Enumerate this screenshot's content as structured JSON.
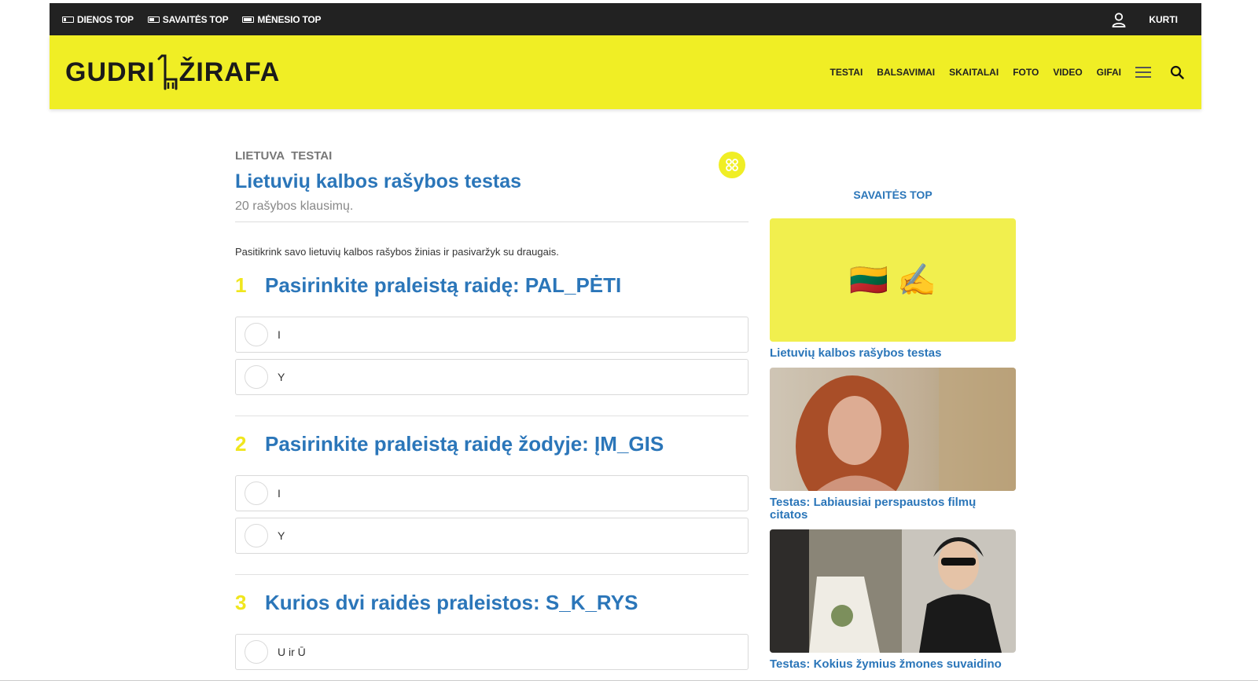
{
  "topbar": {
    "links": [
      {
        "label": "DIENOS TOP"
      },
      {
        "label": "SAVAITĖS TOP"
      },
      {
        "label": "MĖNESIO TOP"
      }
    ],
    "create_label": "KURTI"
  },
  "header": {
    "logo_left": "GUDRI",
    "logo_right": "ŽIRAFA",
    "nav": [
      "TESTAI",
      "BALSAVIMAI",
      "SKAITALAI",
      "FOTO",
      "VIDEO",
      "GIFAI"
    ]
  },
  "article": {
    "categories": [
      "LIETUVA",
      "TESTAI"
    ],
    "title": "Lietuvių kalbos rašybos testas",
    "subtitle": "20 rašybos klausimų.",
    "intro": "Pasitikrink savo lietuvių kalbos rašybos žinias ir pasivaržyk su draugais.",
    "questions": [
      {
        "number": "1",
        "text": "Pasirinkite praleistą raidę: PAL_PĖTI",
        "answers": [
          "I",
          "Y"
        ]
      },
      {
        "number": "2",
        "text": "Pasirinkite praleistą raidę žodyje: ĮM_GIS",
        "answers": [
          "I",
          "Y"
        ]
      },
      {
        "number": "3",
        "text": "Kurios dvi raidės praleistos: S_K_RYS",
        "answers": [
          "U ir Ū"
        ]
      }
    ]
  },
  "sidebar": {
    "title": "SAVAITĖS TOP",
    "cards": [
      {
        "title": "Lietuvių kalbos rašybos testas",
        "emoji": "🇱🇹 ✍️"
      },
      {
        "title": "Testas: Labiausiai perspaustos filmų citatos"
      },
      {
        "title": "Testas: Kokius žymius žmones suvaidino"
      }
    ]
  },
  "colors": {
    "brand_yellow": "#f0ee25",
    "link_blue": "#2b76b9",
    "topbar_black": "#222222"
  }
}
